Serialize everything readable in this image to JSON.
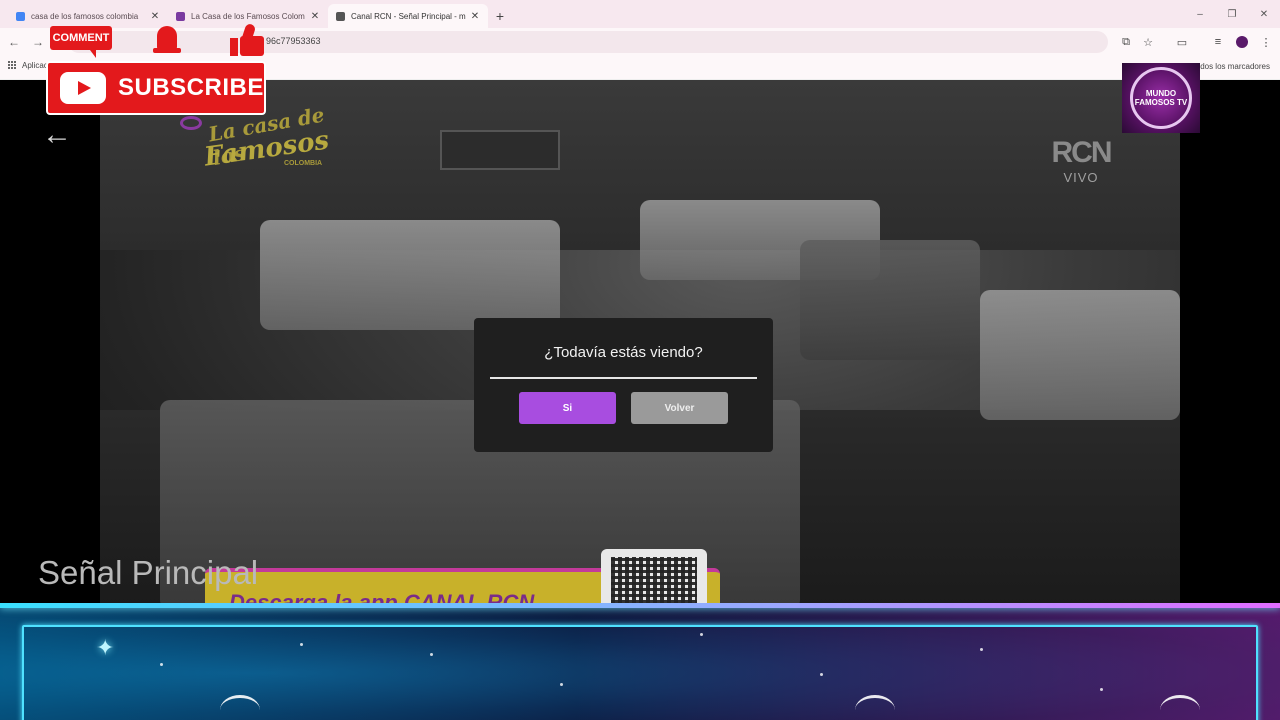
{
  "browser": {
    "tabs": [
      {
        "title": "casa de los famosos colombia",
        "favicon_color": "#4285f4"
      },
      {
        "title": "La Casa de los Famosos Colom",
        "favicon_color": "#7a3aa0"
      },
      {
        "title": "Canal RCN - Señal Principal - m",
        "favicon_color": "#555555"
      }
    ],
    "new_tab": "+",
    "url_fragment": "96c77953363",
    "bookmarks_left": "Aplicac",
    "bookmarks_right": "dos los marcadores"
  },
  "video": {
    "show_logo": {
      "line1": "La casa de los",
      "line2": "Famosos",
      "line3": "COLOMBIA"
    },
    "network": {
      "mark": "RCN",
      "badge": "VIVO"
    },
    "channel_title": "Señal Principal",
    "promo_text": "Descarga la app CANAL RCN"
  },
  "dialog": {
    "title": "¿Todavía estás viendo?",
    "confirm_label": "Si",
    "back_label": "Volver",
    "confirm_color": "#a84de0",
    "back_color": "#9a9a9a"
  },
  "overlay": {
    "comment_label": "COMMENT",
    "subscribe_label": "SUBSCRIBE",
    "channel_logo": {
      "top": "MUNDO",
      "bottom": "FAMOSOS TV"
    }
  },
  "icons": [
    "back-arrow-icon",
    "forward-arrow-icon",
    "reload-icon",
    "translate-icon",
    "star-icon",
    "cast-icon",
    "profile-icon",
    "menu-dots-icon",
    "apps-grid-icon",
    "bell-icon",
    "thumbs-up-icon",
    "youtube-icon",
    "qr-code-icon"
  ]
}
